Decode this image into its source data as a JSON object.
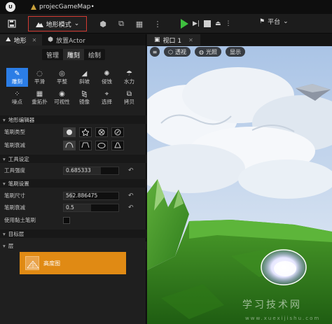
{
  "titlebar": {
    "tab_title": "projecGameMap•"
  },
  "toolbar": {
    "mode_label": "地形模式",
    "platform_label": "平台"
  },
  "left_panel": {
    "tabs": [
      {
        "label": "地形"
      },
      {
        "label": "放置Actor"
      }
    ],
    "sub_tabs": [
      "管理",
      "雕刻",
      "绘制"
    ],
    "active_sub_tab": "雕刻",
    "tools": [
      {
        "label": "雕刻",
        "icon": "sculpt-icon",
        "active": true
      },
      {
        "label": "平滑",
        "icon": "smooth-icon"
      },
      {
        "label": "平整",
        "icon": "flatten-icon"
      },
      {
        "label": "斜坡",
        "icon": "ramp-icon"
      },
      {
        "label": "侵蚀",
        "icon": "erosion-icon"
      },
      {
        "label": "水力",
        "icon": "hydro-icon"
      },
      {
        "label": "噪点",
        "icon": "noise-icon"
      },
      {
        "label": "重拓扑",
        "icon": "retopo-icon"
      },
      {
        "label": "可视性",
        "icon": "visibility-icon"
      },
      {
        "label": "镜像",
        "icon": "mirror-icon"
      },
      {
        "label": "选择",
        "icon": "select-icon"
      },
      {
        "label": "拷贝",
        "icon": "copy-icon"
      }
    ],
    "sections": {
      "editor": "地形编辑器",
      "tool_settings": "工具设定",
      "brush_settings": "笔刷设置",
      "target_layer": "目标层",
      "layers": "层"
    },
    "props": {
      "brush_type_label": "笔刷类型",
      "brush_falloff_label": "笔刷衰减",
      "tool_strength_label": "工具强度",
      "tool_strength_value": "0.685333",
      "brush_size_label": "笔刷尺寸",
      "brush_size_value": "562.886475",
      "brush_falloff2_label": "笔刷衰减",
      "brush_falloff2_value": "0.5",
      "use_clay_label": "使用黏土笔刷"
    },
    "layer_item": "高度图"
  },
  "viewport": {
    "tab_label": "视口 1",
    "perspective_label": "透视",
    "lighting_label": "光照",
    "show_label": "显示"
  },
  "watermark": {
    "text": "学习技术网",
    "url": "www.xuexijishu.com"
  },
  "colors": {
    "accent_blue": "#2b7de6",
    "layer_orange": "#e08a14",
    "highlight_red": "#d23a32",
    "play_green": "#3fbf3f"
  }
}
